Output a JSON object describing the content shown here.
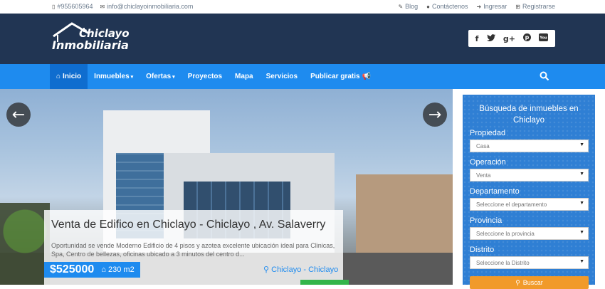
{
  "topbar": {
    "phone": "#955605964",
    "email": "info@chiclayoinmobiliaria.com",
    "links": [
      "Blog",
      "Contáctenos",
      "Ingresar",
      "Registrarse"
    ]
  },
  "logo": {
    "line1": "Chiclayo",
    "line2": "Inmobiliaria"
  },
  "social": [
    "f",
    "t",
    "g+",
    "p",
    "yt"
  ],
  "nav": {
    "items": [
      "Inicio",
      "Inmuebles",
      "Ofertas",
      "Proyectos",
      "Mapa",
      "Servicios",
      "Publicar gratis"
    ],
    "active": "Inicio"
  },
  "listing": {
    "title": "Venta de Edifico en Chiclayo - Chiclayo , Av. Salaverry",
    "description": "Oportunidad se vende Moderno Edificio de 4 pisos y azotea excelente ubicación ideal para Clinicas, Spa, Centro de bellezas, oficinas ubicado a 3 minutos del centro d...",
    "price": "$525000",
    "area": "230 m2",
    "location": "Chiclayo - Chiclayo"
  },
  "search": {
    "title": "Búsqueda de inmuebles en Chiclayo",
    "fields": [
      {
        "label": "Propiedad",
        "value": "Casa"
      },
      {
        "label": "Operación",
        "value": "Venta"
      },
      {
        "label": "Departamento",
        "value": "Seleccione el departamento"
      },
      {
        "label": "Provincia",
        "value": "Seleccione la provincia"
      },
      {
        "label": "Distrito",
        "value": "Seleccione la Distrito"
      }
    ],
    "button": "Buscar"
  },
  "colors": {
    "header": "#213553",
    "nav": "#1e8bef",
    "accent": "#f19a2a"
  }
}
